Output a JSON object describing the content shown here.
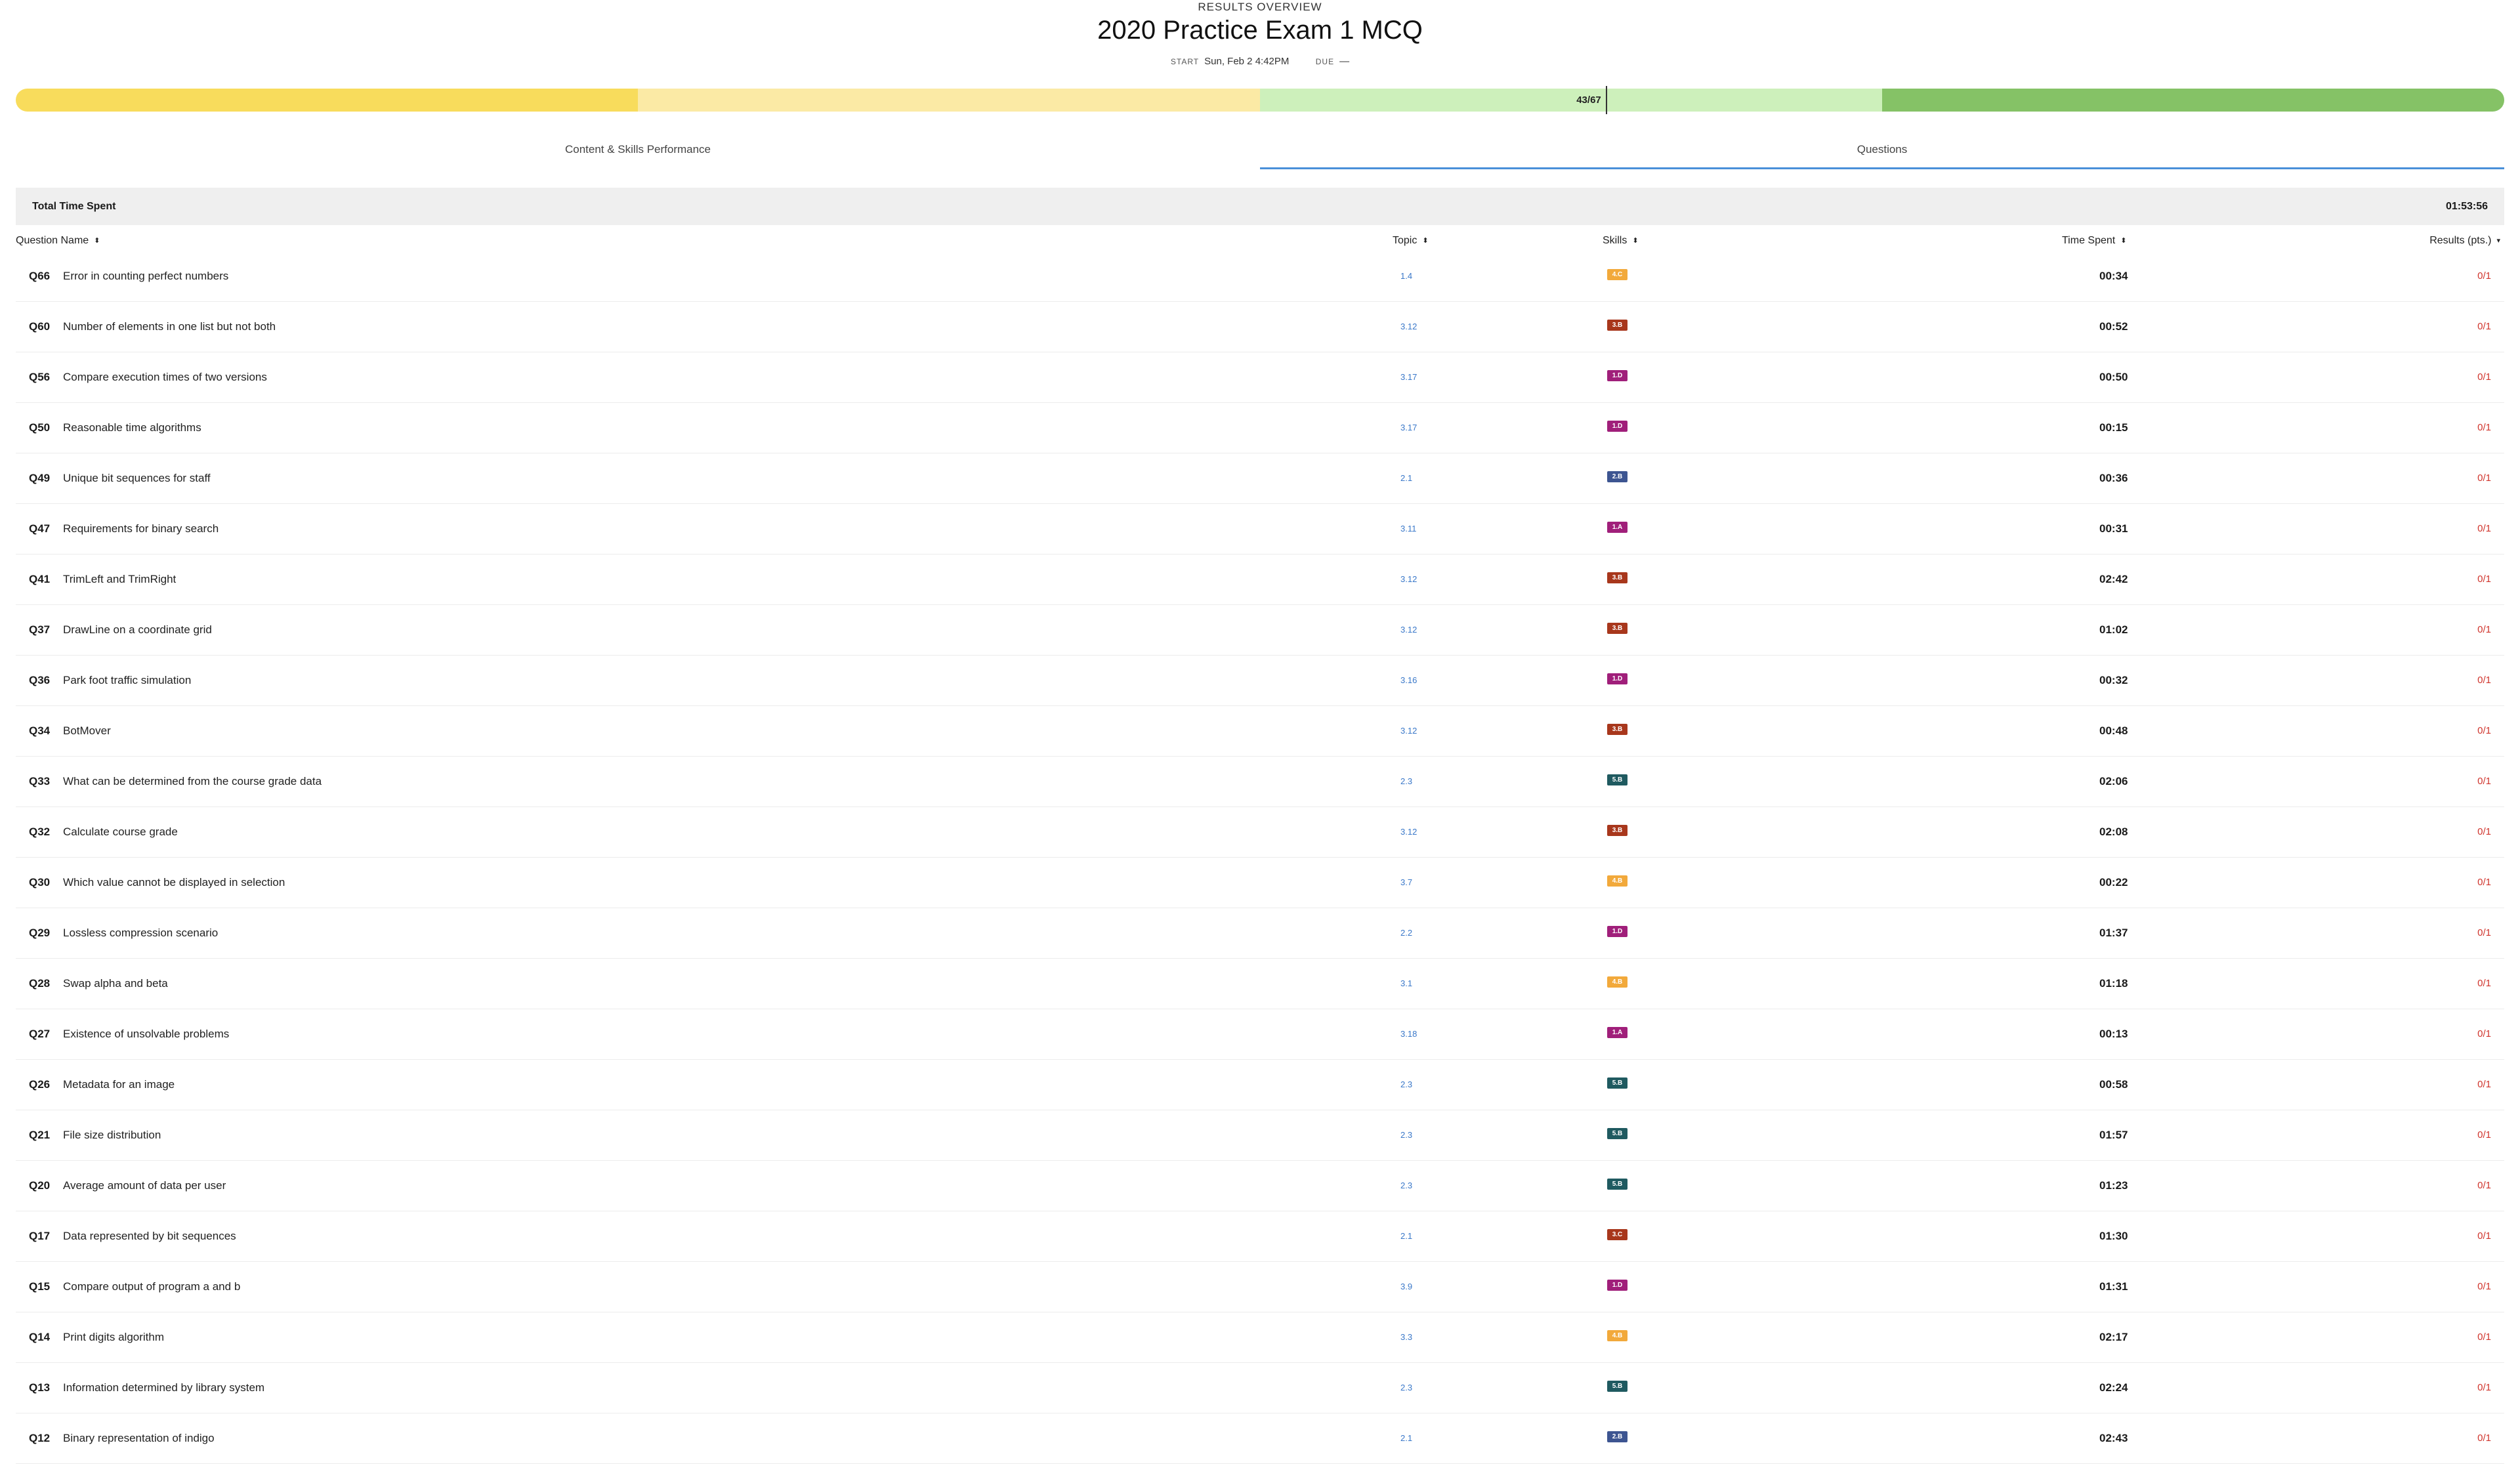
{
  "header": {
    "eyebrow": "RESULTS OVERVIEW",
    "title": "2020 Practice Exam 1 MCQ",
    "start_label": "START",
    "start_value": "Sun, Feb 2 4:42PM",
    "due_label": "DUE",
    "due_value": "—"
  },
  "progress": {
    "label": "43/67",
    "segments": [
      {
        "color": "#f8dc5c"
      },
      {
        "color": "#fbeaa5"
      },
      {
        "color": "#cdf0bb"
      },
      {
        "color": "#85c266"
      }
    ]
  },
  "tabs": [
    {
      "label": "Content & Skills Performance",
      "active": false
    },
    {
      "label": "Questions",
      "active": true
    }
  ],
  "total": {
    "label": "Total Time Spent",
    "value": "01:53:56"
  },
  "columns": {
    "name": "Question Name",
    "topic": "Topic",
    "skills": "Skills",
    "time": "Time Spent",
    "results": "Results (pts.)"
  },
  "skill_colors": {
    "4.C": "#f2a93b",
    "4.B": "#f2a93b",
    "3.B": "#a8371c",
    "3.C": "#a8371c",
    "1.D": "#a01f7a",
    "1.A": "#a01f7a",
    "2.B": "#3d5591",
    "5.B": "#1f5a60"
  },
  "questions": [
    {
      "id": "Q66",
      "name": "Error in counting perfect numbers",
      "topic": "1.4",
      "skill": "4.C",
      "time": "00:34",
      "result": "0/1"
    },
    {
      "id": "Q60",
      "name": "Number of elements in one list but not both",
      "topic": "3.12",
      "skill": "3.B",
      "time": "00:52",
      "result": "0/1"
    },
    {
      "id": "Q56",
      "name": "Compare execution times of two versions",
      "topic": "3.17",
      "skill": "1.D",
      "time": "00:50",
      "result": "0/1"
    },
    {
      "id": "Q50",
      "name": "Reasonable time algorithms",
      "topic": "3.17",
      "skill": "1.D",
      "time": "00:15",
      "result": "0/1"
    },
    {
      "id": "Q49",
      "name": "Unique bit sequences for staff",
      "topic": "2.1",
      "skill": "2.B",
      "time": "00:36",
      "result": "0/1"
    },
    {
      "id": "Q47",
      "name": "Requirements for binary search",
      "topic": "3.11",
      "skill": "1.A",
      "time": "00:31",
      "result": "0/1"
    },
    {
      "id": "Q41",
      "name": "TrimLeft and TrimRight",
      "topic": "3.12",
      "skill": "3.B",
      "time": "02:42",
      "result": "0/1"
    },
    {
      "id": "Q37",
      "name": "DrawLine on a coordinate grid",
      "topic": "3.12",
      "skill": "3.B",
      "time": "01:02",
      "result": "0/1"
    },
    {
      "id": "Q36",
      "name": "Park foot traffic simulation",
      "topic": "3.16",
      "skill": "1.D",
      "time": "00:32",
      "result": "0/1"
    },
    {
      "id": "Q34",
      "name": "BotMover",
      "topic": "3.12",
      "skill": "3.B",
      "time": "00:48",
      "result": "0/1"
    },
    {
      "id": "Q33",
      "name": "What can be determined from the course grade data",
      "topic": "2.3",
      "skill": "5.B",
      "time": "02:06",
      "result": "0/1"
    },
    {
      "id": "Q32",
      "name": "Calculate course grade",
      "topic": "3.12",
      "skill": "3.B",
      "time": "02:08",
      "result": "0/1"
    },
    {
      "id": "Q30",
      "name": "Which value cannot be displayed in selection",
      "topic": "3.7",
      "skill": "4.B",
      "time": "00:22",
      "result": "0/1"
    },
    {
      "id": "Q29",
      "name": "Lossless compression scenario",
      "topic": "2.2",
      "skill": "1.D",
      "time": "01:37",
      "result": "0/1"
    },
    {
      "id": "Q28",
      "name": "Swap alpha and beta",
      "topic": "3.1",
      "skill": "4.B",
      "time": "01:18",
      "result": "0/1"
    },
    {
      "id": "Q27",
      "name": "Existence of unsolvable problems",
      "topic": "3.18",
      "skill": "1.A",
      "time": "00:13",
      "result": "0/1"
    },
    {
      "id": "Q26",
      "name": "Metadata for an image",
      "topic": "2.3",
      "skill": "5.B",
      "time": "00:58",
      "result": "0/1"
    },
    {
      "id": "Q21",
      "name": "File size distribution",
      "topic": "2.3",
      "skill": "5.B",
      "time": "01:57",
      "result": "0/1"
    },
    {
      "id": "Q20",
      "name": "Average amount of data per user",
      "topic": "2.3",
      "skill": "5.B",
      "time": "01:23",
      "result": "0/1"
    },
    {
      "id": "Q17",
      "name": "Data represented by bit sequences",
      "topic": "2.1",
      "skill": "3.C",
      "time": "01:30",
      "result": "0/1"
    },
    {
      "id": "Q15",
      "name": "Compare output of program a and b",
      "topic": "3.9",
      "skill": "1.D",
      "time": "01:31",
      "result": "0/1"
    },
    {
      "id": "Q14",
      "name": "Print digits algorithm",
      "topic": "3.3",
      "skill": "4.B",
      "time": "02:17",
      "result": "0/1"
    },
    {
      "id": "Q13",
      "name": "Information determined by library system",
      "topic": "2.3",
      "skill": "5.B",
      "time": "02:24",
      "result": "0/1"
    },
    {
      "id": "Q12",
      "name": "Binary representation of indigo",
      "topic": "2.1",
      "skill": "2.B",
      "time": "02:43",
      "result": "0/1"
    }
  ]
}
